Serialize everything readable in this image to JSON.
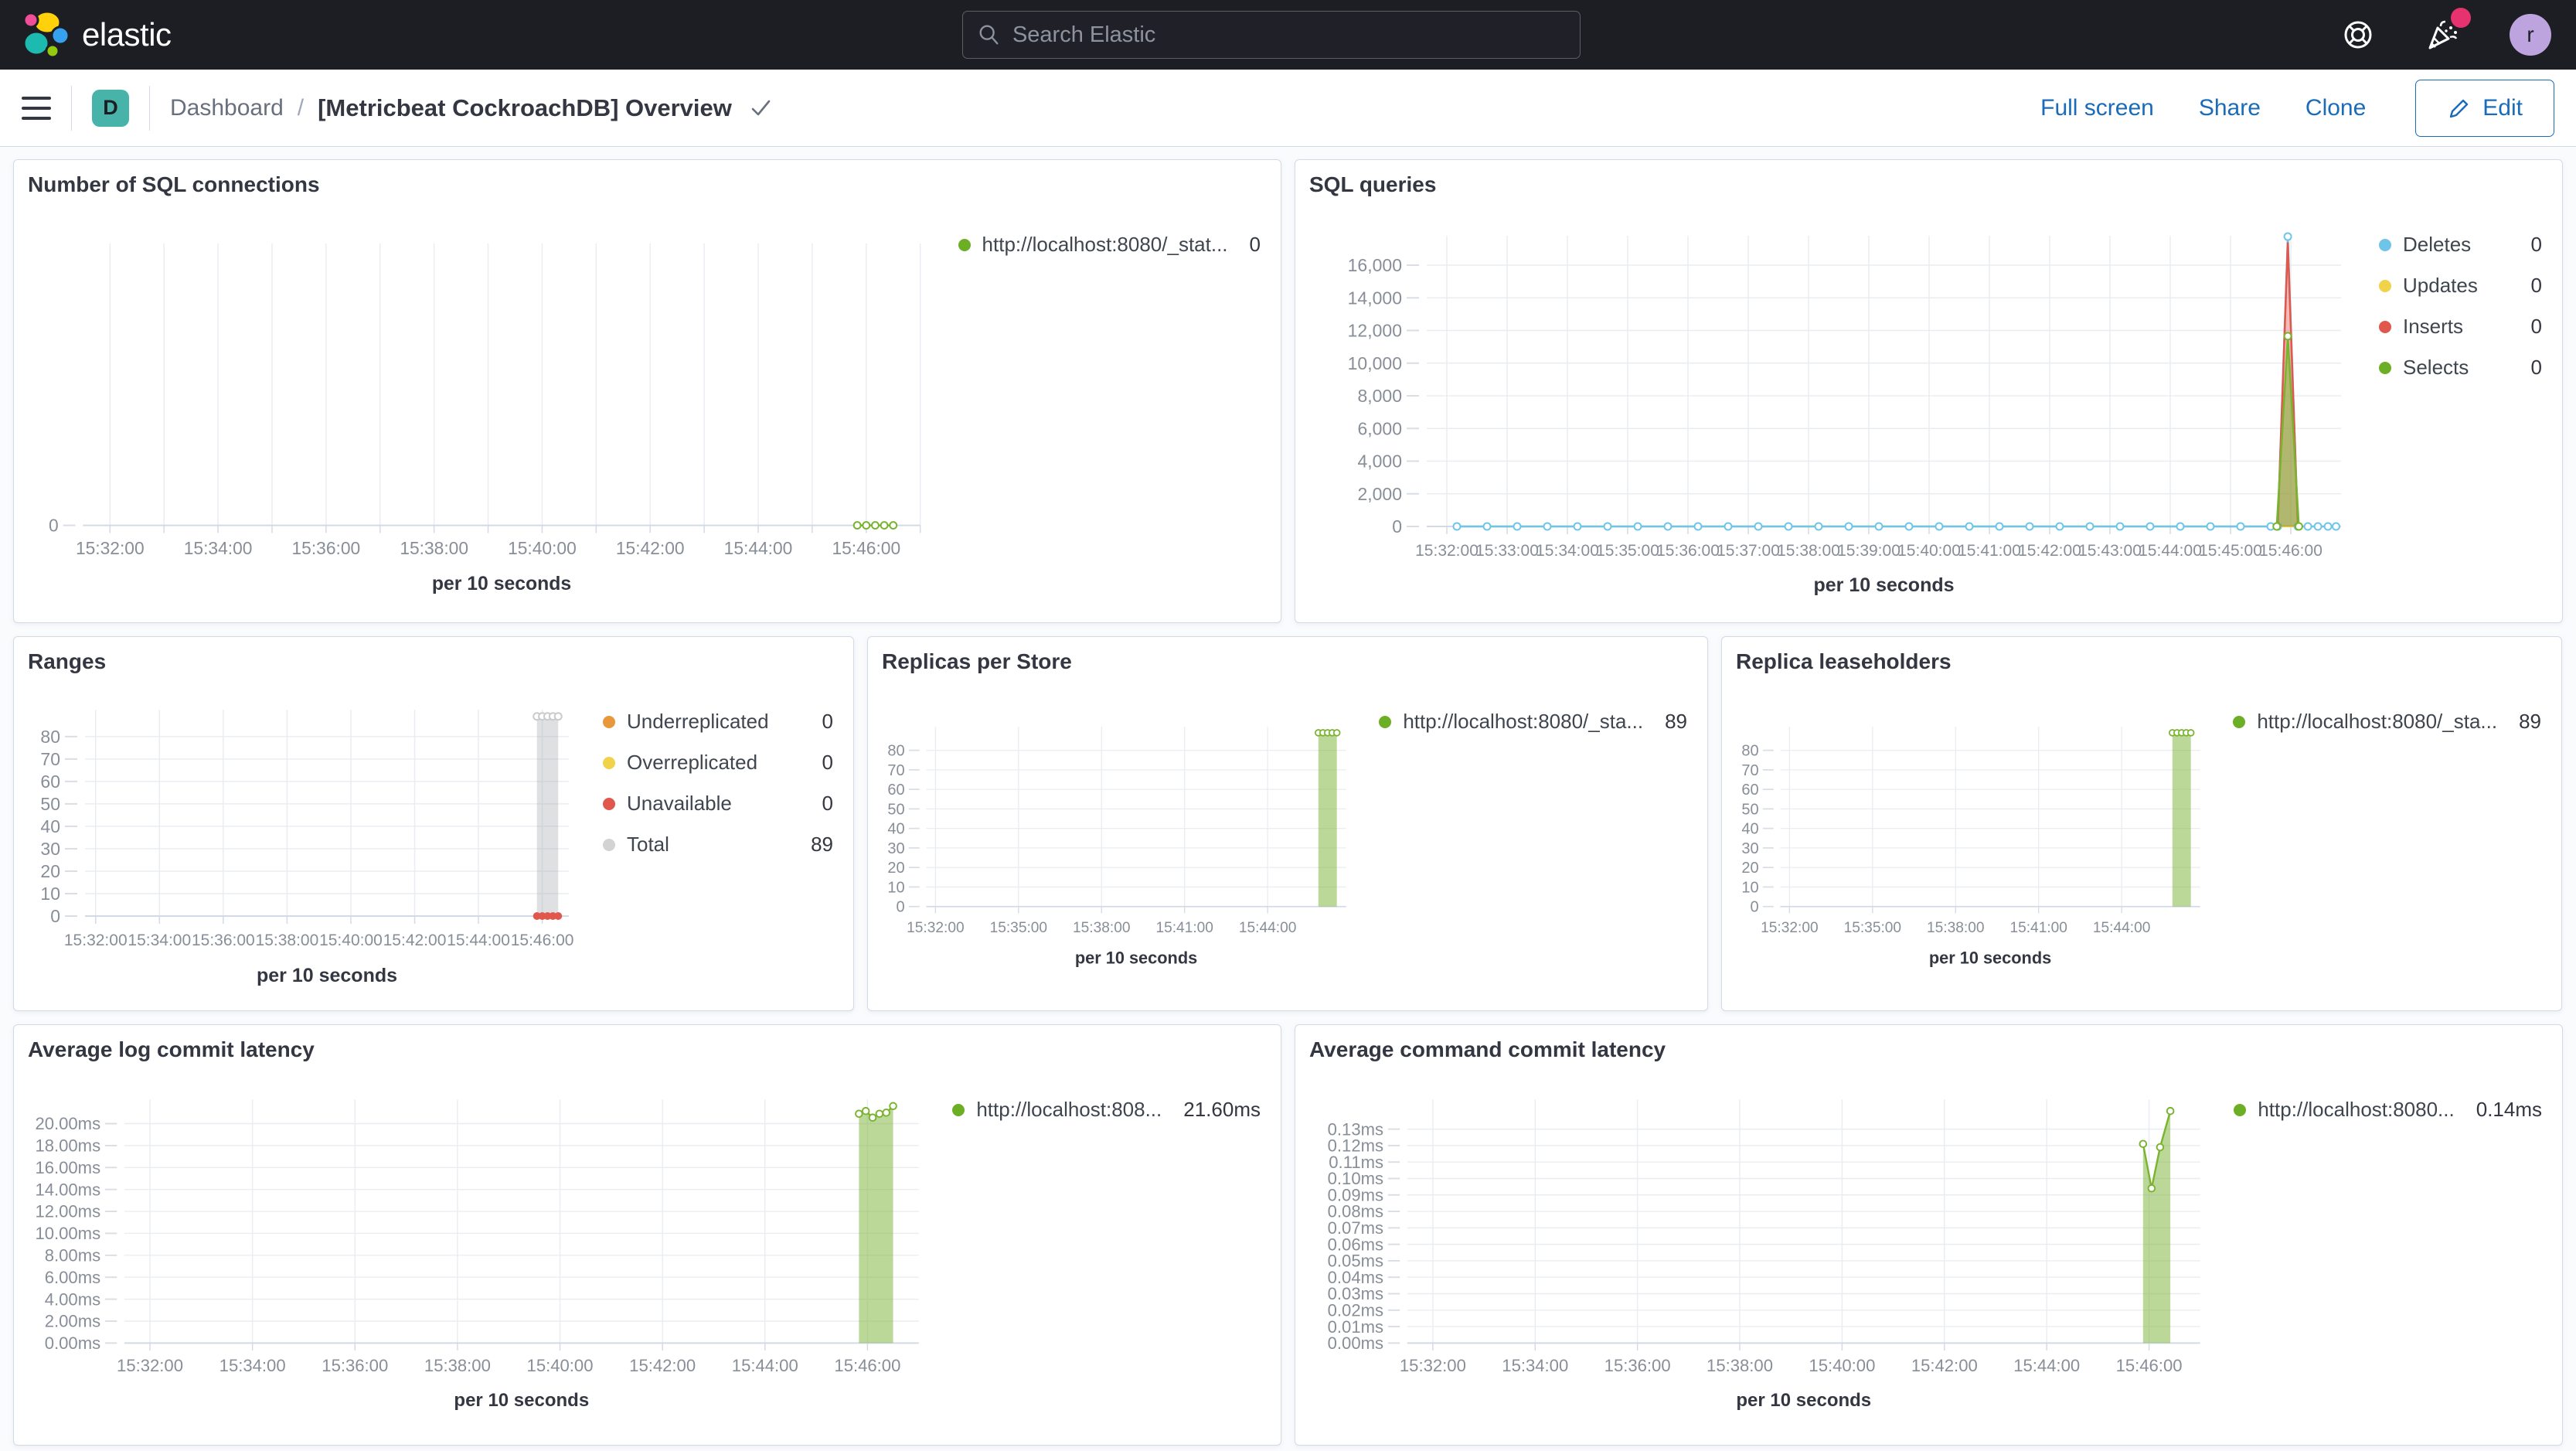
{
  "header": {
    "brand": "elastic",
    "search_placeholder": "Search Elastic",
    "avatar_letter": "r"
  },
  "icons": {
    "search": "magnifier",
    "help": "life-ring",
    "news": "party-popper",
    "menu": "hamburger",
    "edit": "pencil",
    "title_caret": "check"
  },
  "breadcrumb": {
    "app_badge": "D",
    "section": "Dashboard",
    "separator": "/",
    "title": "[Metricbeat CockroachDB] Overview"
  },
  "actions": {
    "full_screen": "Full screen",
    "share": "Share",
    "clone": "Clone",
    "edit": "Edit"
  },
  "colors": {
    "green": "#79b32f",
    "light_blue": "#6ec5e8",
    "yellow": "#f0d34a",
    "red": "#e0584d",
    "orange": "#e8973b",
    "gray": "#c9cbcd",
    "teal_badge": "#48b3a9",
    "link_blue": "#1a6bba",
    "header_bg": "#1d1e24"
  },
  "chart_data": [
    {
      "id": "sql_connections",
      "type": "line",
      "title": "Number of SQL connections",
      "xlabel": "per 10 seconds",
      "x_domain": [
        "15:31:30",
        "15:47:00"
      ],
      "x_grid_start": "15:32:00",
      "x_grid_every_s": 60,
      "x_tick_labels": [
        "15:32:00",
        "15:34:00",
        "15:36:00",
        "15:38:00",
        "15:40:00",
        "15:42:00",
        "15:44:00",
        "15:46:00"
      ],
      "y_domain": [
        0,
        1
      ],
      "y_ticks": [
        {
          "v": 0,
          "label": "0"
        }
      ],
      "legend": [
        {
          "label": "http://localhost:8080/_stat...",
          "value": "0",
          "color": "#6dae27"
        }
      ],
      "series": [
        {
          "name": "connections",
          "type": "line",
          "color": "#79b32f",
          "marker": "open",
          "points": [
            [
              "15:45:50",
              0
            ],
            [
              "15:46:00",
              0
            ],
            [
              "15:46:10",
              0
            ],
            [
              "15:46:20",
              0
            ],
            [
              "15:46:30",
              0
            ]
          ]
        }
      ]
    },
    {
      "id": "sql_queries",
      "type": "line",
      "title": "SQL queries",
      "xlabel": "per 10 seconds",
      "x_domain": [
        "15:31:40",
        "15:46:50"
      ],
      "x_grid_start": "15:32:00",
      "x_grid_every_s": 60,
      "x_tick_labels": [
        "15:32:00",
        "15:33:00",
        "15:34:00",
        "15:35:00",
        "15:36:00",
        "15:37:00",
        "15:38:00",
        "15:39:00",
        "15:40:00",
        "15:41:00",
        "15:42:00",
        "15:43:00",
        "15:44:00",
        "15:45:00",
        "15:46:00"
      ],
      "y_domain": [
        0,
        17800
      ],
      "y_ticks": [
        {
          "v": 0,
          "label": "0"
        },
        {
          "v": 2000,
          "label": "2,000"
        },
        {
          "v": 4000,
          "label": "4,000"
        },
        {
          "v": 6000,
          "label": "6,000"
        },
        {
          "v": 8000,
          "label": "8,000"
        },
        {
          "v": 10000,
          "label": "10,000"
        },
        {
          "v": 12000,
          "label": "12,000"
        },
        {
          "v": 14000,
          "label": "14,000"
        },
        {
          "v": 16000,
          "label": "16,000"
        }
      ],
      "legend": [
        {
          "label": "Deletes",
          "value": "0",
          "color": "#6ec5e8"
        },
        {
          "label": "Updates",
          "value": "0",
          "color": "#f0d34a"
        },
        {
          "label": "Inserts",
          "value": "0",
          "color": "#e0584d"
        },
        {
          "label": "Selects",
          "value": "0",
          "color": "#6dae27"
        }
      ],
      "series": [
        {
          "name": "Updates",
          "type": "line",
          "color": "#f0d34a",
          "marker": "none",
          "points": [
            [
              "15:32:10",
              0
            ],
            [
              "15:46:45",
              0
            ]
          ]
        },
        {
          "name": "Deletes",
          "type": "line",
          "color": "#6ec5e8",
          "marker": "open",
          "points": [
            [
              "15:32:10",
              0
            ],
            [
              "15:32:40",
              0
            ],
            [
              "15:33:10",
              0
            ],
            [
              "15:33:40",
              0
            ],
            [
              "15:34:10",
              0
            ],
            [
              "15:34:40",
              0
            ],
            [
              "15:35:10",
              0
            ],
            [
              "15:35:40",
              0
            ],
            [
              "15:36:10",
              0
            ],
            [
              "15:36:40",
              0
            ],
            [
              "15:37:10",
              0
            ],
            [
              "15:37:40",
              0
            ],
            [
              "15:38:10",
              0
            ],
            [
              "15:38:40",
              0
            ],
            [
              "15:39:10",
              0
            ],
            [
              "15:39:40",
              0
            ],
            [
              "15:40:10",
              0
            ],
            [
              "15:40:40",
              0
            ],
            [
              "15:41:10",
              0
            ],
            [
              "15:41:40",
              0
            ],
            [
              "15:42:10",
              0
            ],
            [
              "15:42:40",
              0
            ],
            [
              "15:43:10",
              0
            ],
            [
              "15:43:40",
              0
            ],
            [
              "15:44:10",
              0
            ],
            [
              "15:44:40",
              0
            ],
            [
              "15:45:10",
              0
            ],
            [
              "15:45:40",
              0
            ],
            [
              "15:45:47",
              0
            ],
            [
              "15:45:57",
              17750
            ],
            [
              "15:46:07",
              0
            ],
            [
              "15:46:17",
              0
            ],
            [
              "15:46:27",
              0
            ],
            [
              "15:46:37",
              0
            ],
            [
              "15:46:45",
              0
            ]
          ]
        },
        {
          "name": "Inserts",
          "type": "area",
          "color": "#e0584d",
          "fill": "rgba(224,88,77,0.40)",
          "marker": "none",
          "points": [
            [
              "15:45:47",
              0
            ],
            [
              "15:45:57",
              17400
            ],
            [
              "15:46:07",
              0
            ]
          ]
        },
        {
          "name": "Selects",
          "type": "area",
          "color": "#79b32f",
          "fill": "rgba(122,178,49,0.55)",
          "marker": "open",
          "points": [
            [
              "15:45:46",
              0
            ],
            [
              "15:45:57",
              11650
            ],
            [
              "15:46:08",
              0
            ]
          ]
        }
      ]
    },
    {
      "id": "ranges",
      "type": "line",
      "title": "Ranges",
      "xlabel": "per 10 seconds",
      "x_domain": [
        "15:31:40",
        "15:46:50"
      ],
      "x_grid_start": "15:32:00",
      "x_grid_every_s": 120,
      "x_tick_labels": [
        "15:32:00",
        "15:34:00",
        "15:36:00",
        "15:38:00",
        "15:40:00",
        "15:42:00",
        "15:44:00",
        "15:46:00"
      ],
      "y_domain": [
        0,
        92
      ],
      "y_ticks": [
        {
          "v": 0,
          "label": "0"
        },
        {
          "v": 10,
          "label": "10"
        },
        {
          "v": 20,
          "label": "20"
        },
        {
          "v": 30,
          "label": "30"
        },
        {
          "v": 40,
          "label": "40"
        },
        {
          "v": 50,
          "label": "50"
        },
        {
          "v": 60,
          "label": "60"
        },
        {
          "v": 70,
          "label": "70"
        },
        {
          "v": 80,
          "label": "80"
        }
      ],
      "legend": [
        {
          "label": "Underreplicated",
          "value": "0",
          "color": "#e8973b"
        },
        {
          "label": "Overreplicated",
          "value": "0",
          "color": "#f0d34a"
        },
        {
          "label": "Unavailable",
          "value": "0",
          "color": "#e0584d"
        },
        {
          "label": "Total",
          "value": "89",
          "color": "#d3d3d3"
        }
      ],
      "series": [
        {
          "name": "Total",
          "type": "area",
          "color": "#c9cbcd",
          "fill": "rgba(170,173,177,0.38)",
          "marker": "open",
          "points": [
            [
              "15:45:50",
              89
            ],
            [
              "15:46:00",
              89
            ],
            [
              "15:46:10",
              89
            ],
            [
              "15:46:20",
              89
            ],
            [
              "15:46:30",
              89
            ]
          ]
        },
        {
          "name": "Underreplicated",
          "type": "line",
          "color": "#e8973b",
          "marker": "none",
          "points": [
            [
              "15:45:50",
              0
            ],
            [
              "15:46:30",
              0
            ]
          ]
        },
        {
          "name": "Overreplicated",
          "type": "line",
          "color": "#f0d34a",
          "marker": "none",
          "points": [
            [
              "15:45:50",
              0
            ],
            [
              "15:46:30",
              0
            ]
          ]
        },
        {
          "name": "Unavailable",
          "type": "line",
          "color": "#e0584d",
          "marker": "filled",
          "points": [
            [
              "15:45:50",
              0
            ],
            [
              "15:46:00",
              0
            ],
            [
              "15:46:10",
              0
            ],
            [
              "15:46:20",
              0
            ],
            [
              "15:46:30",
              0
            ]
          ]
        }
      ]
    },
    {
      "id": "replicas",
      "type": "line",
      "title": "Replicas per Store",
      "xlabel": "per 10 seconds",
      "x_domain": [
        "15:31:40",
        "15:46:50"
      ],
      "x_grid_start": "15:32:00",
      "x_grid_every_s": 180,
      "x_tick_labels": [
        "15:32:00",
        "15:35:00",
        "15:38:00",
        "15:41:00",
        "15:44:00"
      ],
      "y_domain": [
        0,
        92
      ],
      "y_ticks": [
        {
          "v": 0,
          "label": "0"
        },
        {
          "v": 10,
          "label": "10"
        },
        {
          "v": 20,
          "label": "20"
        },
        {
          "v": 30,
          "label": "30"
        },
        {
          "v": 40,
          "label": "40"
        },
        {
          "v": 50,
          "label": "50"
        },
        {
          "v": 60,
          "label": "60"
        },
        {
          "v": 70,
          "label": "70"
        },
        {
          "v": 80,
          "label": "80"
        }
      ],
      "legend": [
        {
          "label": "http://localhost:8080/_sta...",
          "value": "89",
          "color": "#6dae27"
        }
      ],
      "series": [
        {
          "name": "replicas",
          "type": "area",
          "color": "#79b32f",
          "fill": "rgba(122,178,49,0.50)",
          "marker": "open",
          "points": [
            [
              "15:45:50",
              89
            ],
            [
              "15:46:00",
              89
            ],
            [
              "15:46:10",
              89
            ],
            [
              "15:46:20",
              89
            ],
            [
              "15:46:30",
              89
            ]
          ]
        }
      ]
    },
    {
      "id": "leaseholders",
      "type": "line",
      "title": "Replica leaseholders",
      "xlabel": "per 10 seconds",
      "x_domain": [
        "15:31:40",
        "15:46:50"
      ],
      "x_grid_start": "15:32:00",
      "x_grid_every_s": 180,
      "x_tick_labels": [
        "15:32:00",
        "15:35:00",
        "15:38:00",
        "15:41:00",
        "15:44:00"
      ],
      "y_domain": [
        0,
        92
      ],
      "y_ticks": [
        {
          "v": 0,
          "label": "0"
        },
        {
          "v": 10,
          "label": "10"
        },
        {
          "v": 20,
          "label": "20"
        },
        {
          "v": 30,
          "label": "30"
        },
        {
          "v": 40,
          "label": "40"
        },
        {
          "v": 50,
          "label": "50"
        },
        {
          "v": 60,
          "label": "60"
        },
        {
          "v": 70,
          "label": "70"
        },
        {
          "v": 80,
          "label": "80"
        }
      ],
      "legend": [
        {
          "label": "http://localhost:8080/_sta...",
          "value": "89",
          "color": "#6dae27"
        }
      ],
      "series": [
        {
          "name": "leaseholders",
          "type": "area",
          "color": "#79b32f",
          "fill": "rgba(122,178,49,0.50)",
          "marker": "open",
          "points": [
            [
              "15:45:50",
              89
            ],
            [
              "15:46:00",
              89
            ],
            [
              "15:46:10",
              89
            ],
            [
              "15:46:20",
              89
            ],
            [
              "15:46:30",
              89
            ]
          ]
        }
      ]
    },
    {
      "id": "log_latency",
      "type": "line",
      "title": "Average log commit latency",
      "xlabel": "per 10 seconds",
      "x_domain": [
        "15:31:30",
        "15:47:00"
      ],
      "x_grid_start": "15:32:00",
      "x_grid_every_s": 120,
      "x_tick_labels": [
        "15:32:00",
        "15:34:00",
        "15:36:00",
        "15:38:00",
        "15:40:00",
        "15:42:00",
        "15:44:00",
        "15:46:00"
      ],
      "y_domain": [
        0,
        22.2
      ],
      "y_ticks": [
        {
          "v": 0,
          "label": "0.00ms"
        },
        {
          "v": 2,
          "label": "2.00ms"
        },
        {
          "v": 4,
          "label": "4.00ms"
        },
        {
          "v": 6,
          "label": "6.00ms"
        },
        {
          "v": 8,
          "label": "8.00ms"
        },
        {
          "v": 10,
          "label": "10.00ms"
        },
        {
          "v": 12,
          "label": "12.00ms"
        },
        {
          "v": 14,
          "label": "14.00ms"
        },
        {
          "v": 16,
          "label": "16.00ms"
        },
        {
          "v": 18,
          "label": "18.00ms"
        },
        {
          "v": 20,
          "label": "20.00ms"
        }
      ],
      "legend": [
        {
          "label": "http://localhost:808...",
          "value": "21.60ms",
          "color": "#6dae27"
        }
      ],
      "series": [
        {
          "name": "log latency",
          "type": "area",
          "color": "#79b32f",
          "fill": "rgba(122,178,49,0.50)",
          "marker": "open",
          "points": [
            [
              "15:45:50",
              20.9
            ],
            [
              "15:45:58",
              21.15
            ],
            [
              "15:46:06",
              20.55
            ],
            [
              "15:46:14",
              20.9
            ],
            [
              "15:46:22",
              21.0
            ],
            [
              "15:46:30",
              21.6
            ]
          ]
        }
      ]
    },
    {
      "id": "cmd_latency",
      "type": "line",
      "title": "Average command commit latency",
      "xlabel": "per 10 seconds",
      "x_domain": [
        "15:31:30",
        "15:47:00"
      ],
      "x_grid_start": "15:32:00",
      "x_grid_every_s": 120,
      "x_tick_labels": [
        "15:32:00",
        "15:34:00",
        "15:36:00",
        "15:38:00",
        "15:40:00",
        "15:42:00",
        "15:44:00",
        "15:46:00"
      ],
      "y_domain": [
        0,
        0.148
      ],
      "y_ticks": [
        {
          "v": 0,
          "label": "0.00ms"
        },
        {
          "v": 0.01,
          "label": "0.01ms"
        },
        {
          "v": 0.02,
          "label": "0.02ms"
        },
        {
          "v": 0.03,
          "label": "0.03ms"
        },
        {
          "v": 0.04,
          "label": "0.04ms"
        },
        {
          "v": 0.05,
          "label": "0.05ms"
        },
        {
          "v": 0.06,
          "label": "0.06ms"
        },
        {
          "v": 0.07,
          "label": "0.07ms"
        },
        {
          "v": 0.08,
          "label": "0.08ms"
        },
        {
          "v": 0.09,
          "label": "0.09ms"
        },
        {
          "v": 0.1,
          "label": "0.10ms"
        },
        {
          "v": 0.11,
          "label": "0.11ms"
        },
        {
          "v": 0.12,
          "label": "0.12ms"
        },
        {
          "v": 0.13,
          "label": "0.13ms"
        }
      ],
      "legend": [
        {
          "label": "http://localhost:8080...",
          "value": "0.14ms",
          "color": "#6dae27"
        }
      ],
      "series": [
        {
          "name": "command latency",
          "type": "area",
          "color": "#79b32f",
          "fill": "rgba(122,178,49,0.50)",
          "marker": "open",
          "points": [
            [
              "15:45:53",
              0.121
            ],
            [
              "15:46:03",
              0.094
            ],
            [
              "15:46:13",
              0.119
            ],
            [
              "15:46:25",
              0.141
            ]
          ]
        }
      ]
    }
  ]
}
